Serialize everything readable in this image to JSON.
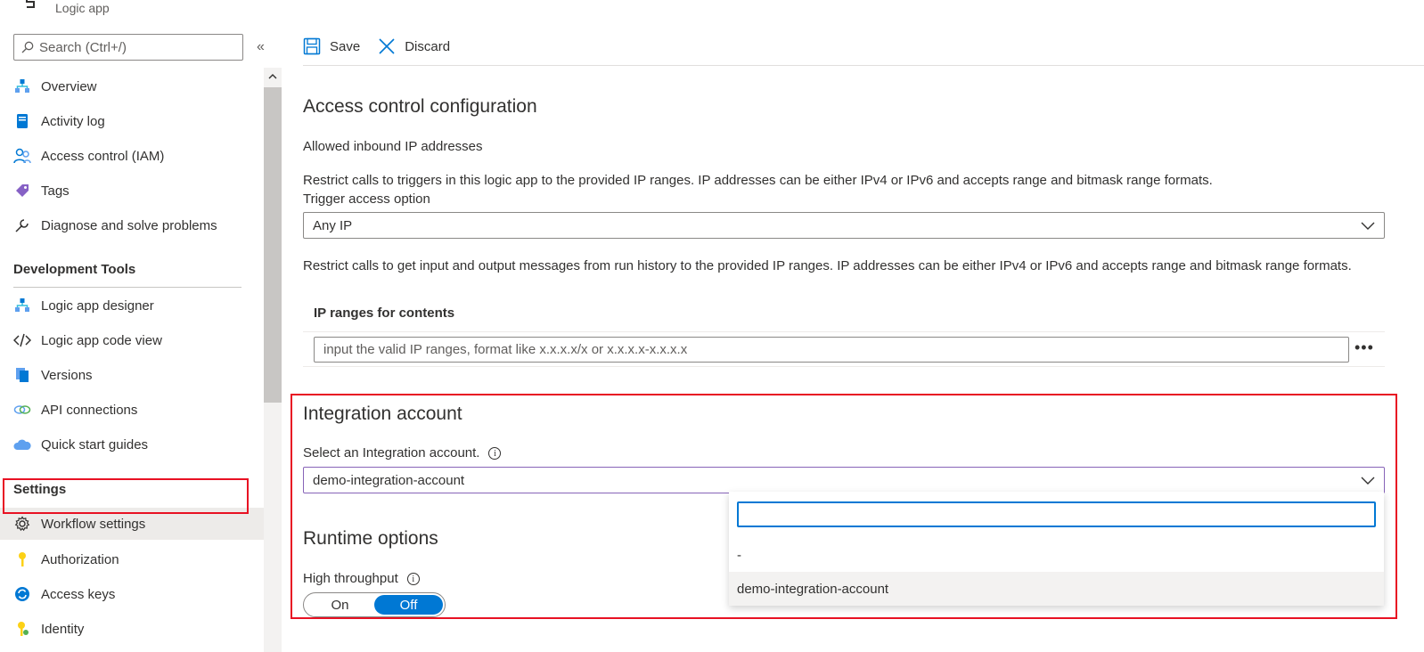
{
  "header": {
    "subtitle": "Logic app"
  },
  "sidebar": {
    "search_placeholder": "Search (Ctrl+/)",
    "collapse_icon": "double-chevron-left-icon",
    "items_top": [
      {
        "label": "Overview",
        "icon": "overview-icon"
      },
      {
        "label": "Activity log",
        "icon": "activity-log-icon"
      },
      {
        "label": "Access control (IAM)",
        "icon": "people-icon"
      },
      {
        "label": "Tags",
        "icon": "tag-icon"
      },
      {
        "label": "Diagnose and solve problems",
        "icon": "wrench-icon"
      }
    ],
    "section_dev": "Development Tools",
    "items_dev": [
      {
        "label": "Logic app designer",
        "icon": "designer-icon"
      },
      {
        "label": "Logic app code view",
        "icon": "code-icon"
      },
      {
        "label": "Versions",
        "icon": "versions-icon"
      },
      {
        "label": "API connections",
        "icon": "link-icon"
      },
      {
        "label": "Quick start guides",
        "icon": "cloud-icon"
      }
    ],
    "section_settings": "Settings",
    "items_settings": [
      {
        "label": "Workflow settings",
        "icon": "gear-icon",
        "selected": true
      },
      {
        "label": "Authorization",
        "icon": "key-icon"
      },
      {
        "label": "Access keys",
        "icon": "sync-icon"
      },
      {
        "label": "Identity",
        "icon": "identity-key-icon"
      }
    ]
  },
  "toolbar": {
    "save_label": "Save",
    "discard_label": "Discard"
  },
  "main": {
    "access_title": "Access control configuration",
    "allowed_inbound": "Allowed inbound IP addresses",
    "restrict_triggers": "Restrict calls to triggers in this logic app to the provided IP ranges. IP addresses can be either IPv4 or IPv6 and accepts range and bitmask range formats.",
    "trigger_access_label": "Trigger access option",
    "trigger_access_value": "Any IP",
    "restrict_run_history": "Restrict calls to get input and output messages from run history to the provided IP ranges. IP addresses can be either IPv4 or IPv6 and accepts range and bitmask range formats.",
    "ip_ranges_header": "IP ranges for contents",
    "ip_input_placeholder": "input the valid IP ranges, format like x.x.x.x/x or x.x.x.x-x.x.x.x",
    "more_label": "•••",
    "integration_title": "Integration account",
    "integration_select_label": "Select an Integration account.",
    "integration_value": "demo-integration-account",
    "runtime_title": "Runtime options",
    "high_throughput_label": "High throughput",
    "toggle_on": "On",
    "toggle_off": "Off",
    "toggle_selected": "Off",
    "info_glyph": "i"
  },
  "dropdown_menu": {
    "search_value": "",
    "options": [
      "-",
      "demo-integration-account"
    ],
    "hovered": "demo-integration-account"
  },
  "colors": {
    "accent": "#0078d4",
    "highlight_box": "#e81123",
    "active_border": "#8764b8"
  }
}
